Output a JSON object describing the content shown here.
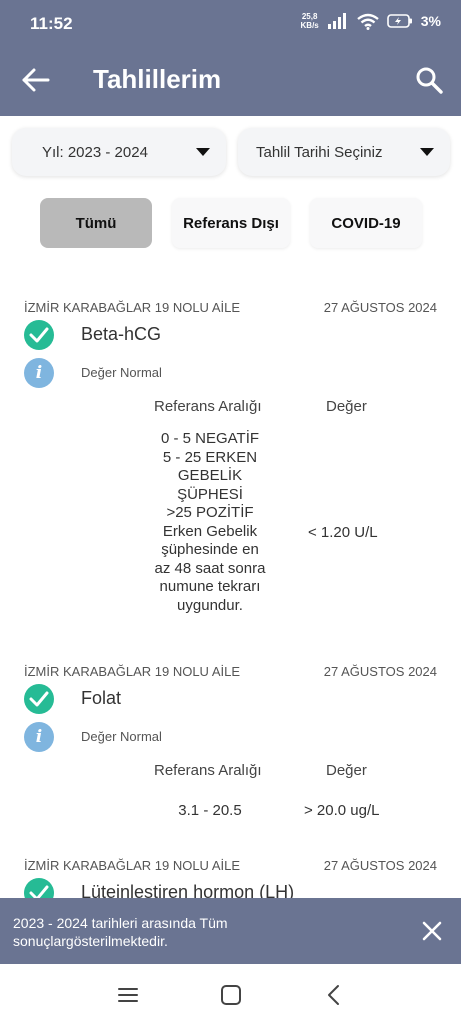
{
  "status_bar": {
    "time": "11:52",
    "net_speed_value": "25,8",
    "net_speed_unit": "KB/s",
    "battery": "3%"
  },
  "app_bar": {
    "title": "Tahlillerim",
    "back_icon": "arrow-left-icon",
    "search_icon": "search-icon"
  },
  "filters": {
    "year": "Yıl: 2023 - 2024",
    "date": "Tahlil Tarihi Seçiniz"
  },
  "chips": {
    "all": "Tümü",
    "out_of_ref": "Referans Dışı",
    "covid": "COVID-19"
  },
  "columns": {
    "reference": "Referans Aralığı",
    "value": "Değer"
  },
  "results": [
    {
      "lab": "İZMİR KARABAĞLAR 19 NOLU AİLE",
      "date": "27 AĞUSTOS 2024",
      "test": "Beta-hCG",
      "status": "Değer Normal",
      "reference_lines": [
        "0 - 5  NEGATİF",
        "5 - 25 ERKEN",
        "GEBELİK",
        "ŞÜPHESİ",
        ">25    POZİTİF",
        "Erken Gebelik",
        "şüphesinde en",
        "az 48 saat sonra",
        "numune tekrarı",
        "uygundur."
      ],
      "value": "< 1.20  U/L"
    },
    {
      "lab": "İZMİR KARABAĞLAR 19 NOLU AİLE",
      "date": "27 AĞUSTOS 2024",
      "test": "Folat",
      "status": "Değer Normal",
      "reference_lines": [
        "3.1 - 20.5"
      ],
      "value": "> 20.0  ug/L"
    },
    {
      "lab": "İZMİR KARABAĞLAR 19 NOLU AİLE",
      "date": "27 AĞUSTOS 2024",
      "test": "Lüteinleştiren hormon (LH)"
    }
  ],
  "snackbar": {
    "message": "2023 - 2024 tarihleri arasında Tüm sonuçlargösterilmektedir.",
    "close_icon": "close-icon"
  },
  "colors": {
    "app_bar": "#6a7492",
    "check": "#26bb95",
    "info": "#7fb5df",
    "chip_selected": "#b9b9b9"
  }
}
